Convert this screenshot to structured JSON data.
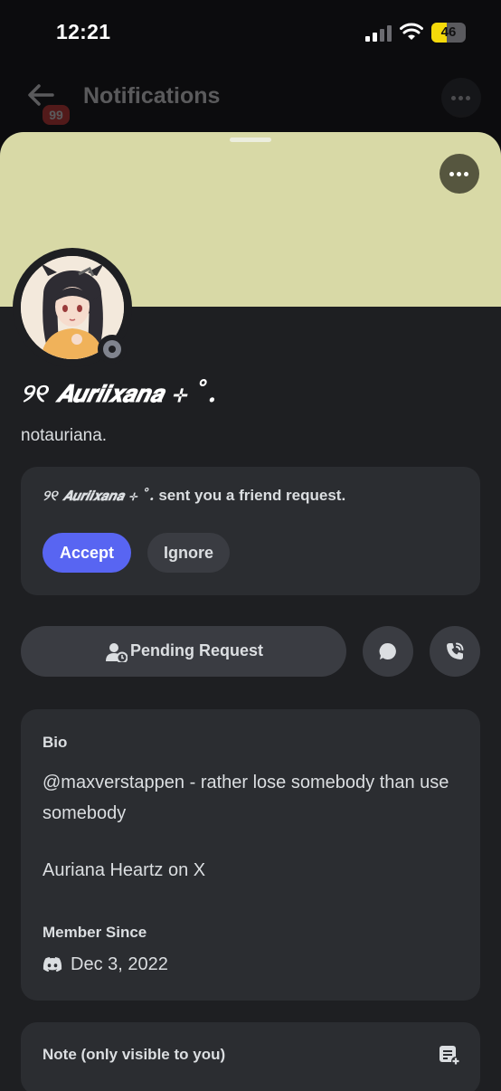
{
  "status_bar": {
    "time": "12:21",
    "battery": "46",
    "battery_level": 0.46
  },
  "background_header": {
    "title": "Notifications",
    "badge": "99"
  },
  "profile": {
    "banner_color": "#d8d9a6",
    "display_name": "୨୧ 𝘼𝙪𝙧𝙞𝙞𝙭𝙖𝙣𝙖 ⊹ ˚.",
    "username": "notauriana.",
    "status": "offline"
  },
  "friend_request": {
    "sender": "୨୧ 𝘼𝙪𝙧𝙞𝙞𝙭𝙖𝙣𝙖 ⊹ ˚.",
    "message": "sent you a friend request.",
    "accept_label": "Accept",
    "ignore_label": "Ignore"
  },
  "actions": {
    "pending_label": "Pending Request",
    "message_icon": "chat-bubble-icon",
    "call_icon": "phone-call-icon"
  },
  "bio": {
    "heading": "Bio",
    "text": "@maxverstappen - rather lose somebody than use somebody",
    "line2": "Auriana Heartz on X",
    "member_heading": "Member Since",
    "member_date": "Dec 3, 2022"
  },
  "note": {
    "label": "Note (only visible to you)"
  },
  "colors": {
    "accent": "#5865f2",
    "card": "#2b2d31",
    "sheet": "#1e1f22"
  }
}
